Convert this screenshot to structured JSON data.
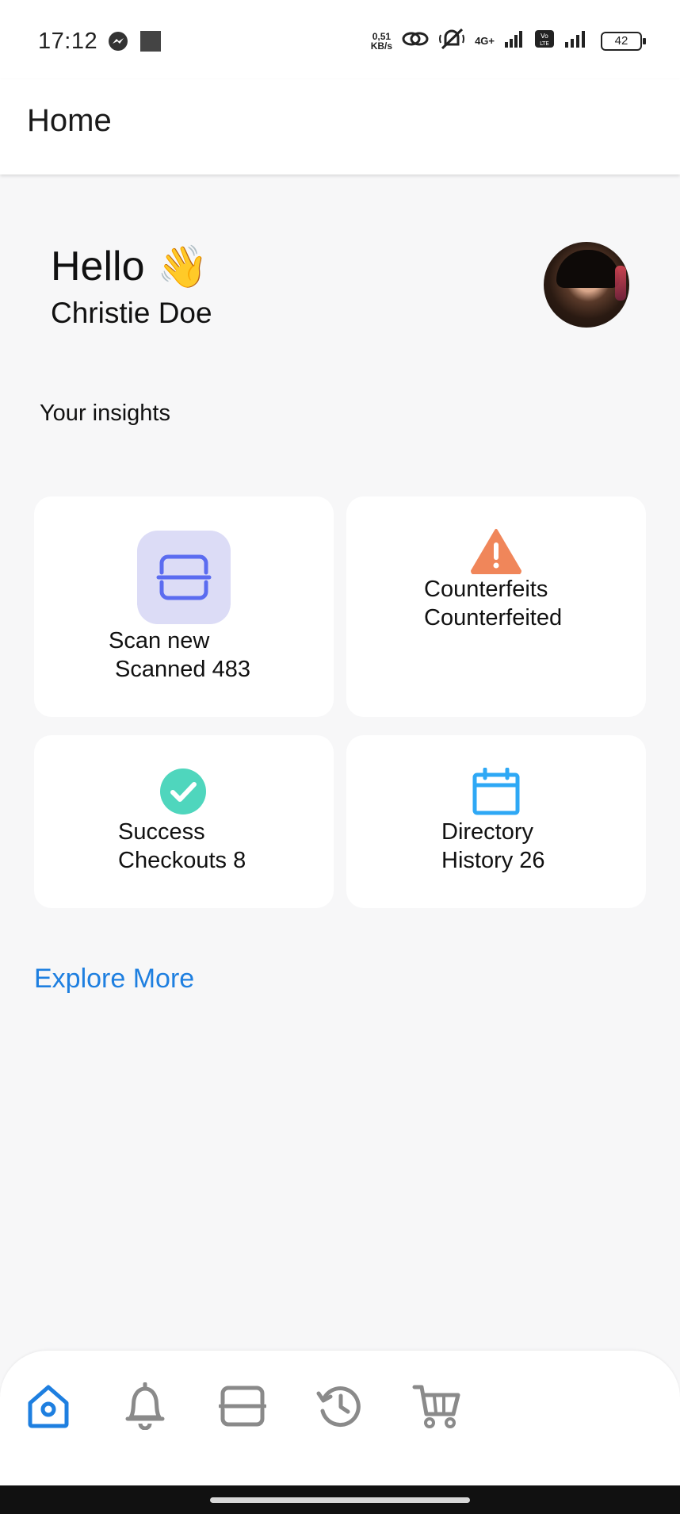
{
  "status_bar": {
    "time": "17:12",
    "net_speed_value": "0,51",
    "net_speed_unit": "KB/s",
    "network_label": "4G+",
    "volte_label": "Vo LTE",
    "battery": "42",
    "icons": [
      "messenger-icon",
      "square-notification-icon",
      "link-icon",
      "vibrate-off-icon",
      "signal-icon",
      "signal-icon",
      "battery-icon"
    ]
  },
  "header": {
    "title": "Home"
  },
  "greeting": {
    "hello": "Hello",
    "wave_emoji": "👋",
    "name": "Christie Doe"
  },
  "insights": {
    "title": "Your insights",
    "cards": [
      {
        "id": "scan",
        "icon": "scan-icon",
        "line1": "Scan new",
        "line2": " Scanned 483",
        "color": "#5b6cf0"
      },
      {
        "id": "counterfeits",
        "icon": "warning-icon",
        "line1": "Counterfeits",
        "line2": "Counterfeited",
        "color": "#f0865a"
      },
      {
        "id": "success",
        "icon": "check-circle-icon",
        "line1": "Success",
        "line2": "Checkouts 8",
        "color": "#4fd6bd"
      },
      {
        "id": "directory",
        "icon": "calendar-icon",
        "line1": "Directory",
        "line2": "History 26",
        "color": "#2ea8f5"
      }
    ]
  },
  "explore_more": "Explore More",
  "bottom_nav": {
    "active": "home",
    "items": [
      {
        "id": "home",
        "icon": "home-icon"
      },
      {
        "id": "notifications",
        "icon": "bell-icon"
      },
      {
        "id": "scan",
        "icon": "scan-icon"
      },
      {
        "id": "history",
        "icon": "history-icon"
      },
      {
        "id": "cart",
        "icon": "cart-icon"
      }
    ]
  },
  "colors": {
    "accent": "#1e7fe0",
    "background": "#f7f7f8",
    "card": "#ffffff",
    "nav_inactive": "#8a8a8a"
  }
}
